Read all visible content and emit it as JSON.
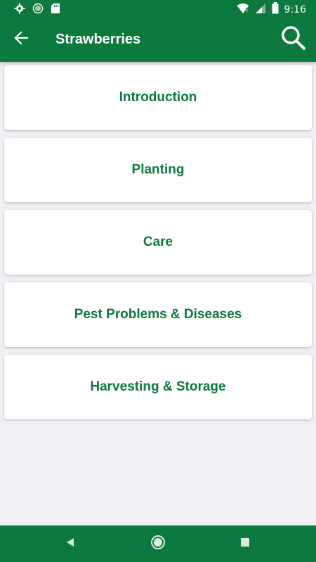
{
  "status_bar": {
    "time": "9:16",
    "left_icons": [
      "gear-icon",
      "sync-icon",
      "sd-card-icon"
    ],
    "right_icons": [
      "wifi-icon",
      "signal-icon",
      "battery-icon"
    ]
  },
  "app_bar": {
    "title": "Strawberries",
    "back_icon": "arrow-left-icon",
    "search_icon": "search-icon"
  },
  "sections": [
    {
      "label": "Introduction"
    },
    {
      "label": "Planting"
    },
    {
      "label": "Care"
    },
    {
      "label": "Pest Problems & Diseases"
    },
    {
      "label": "Harvesting & Storage"
    }
  ],
  "nav_bar": {
    "buttons": [
      "back-triangle-icon",
      "home-circle-icon",
      "recents-square-icon"
    ]
  },
  "colors": {
    "primary": "#0c7a3e",
    "background": "#eef0f3",
    "card": "#ffffff"
  }
}
